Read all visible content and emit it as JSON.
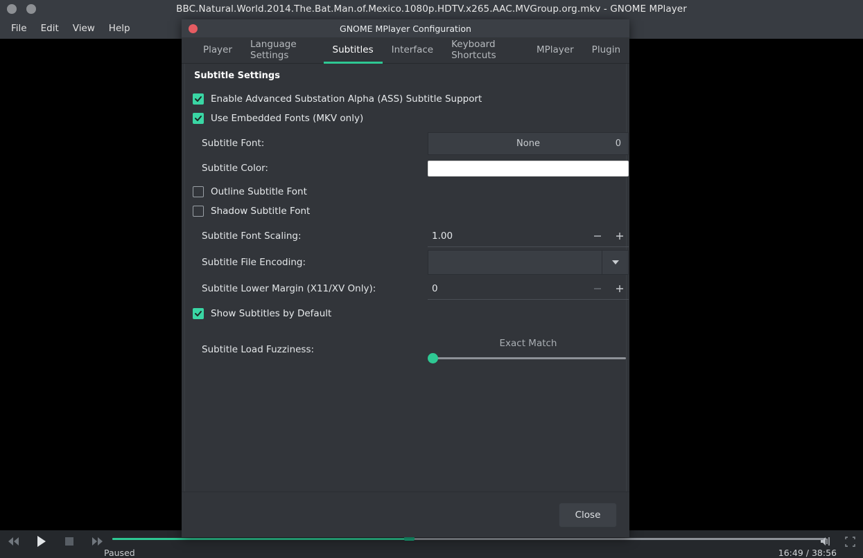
{
  "window": {
    "title": "BBC.Natural.World.2014.The.Bat.Man.of.Mexico.1080p.HDTV.x265.AAC.MVGroup.org.mkv - GNOME MPlayer",
    "menu": [
      "File",
      "Edit",
      "View",
      "Help"
    ]
  },
  "player": {
    "status": "Paused",
    "timecode": "16:49 / 38:56",
    "accent_color": "#2ec893",
    "icons": {
      "rewind": "rewind-icon",
      "play": "play-icon",
      "stop": "stop-icon",
      "forward": "fast-forward-icon",
      "volume": "volume-icon",
      "fullscreen": "fullscreen-icon"
    }
  },
  "dialog": {
    "title": "GNOME MPlayer Configuration",
    "tabs": [
      {
        "label": "Player",
        "active": false
      },
      {
        "label": "Language Settings",
        "active": false
      },
      {
        "label": "Subtitles",
        "active": true
      },
      {
        "label": "Interface",
        "active": false
      },
      {
        "label": "Keyboard Shortcuts",
        "active": false
      },
      {
        "label": "MPlayer",
        "active": false
      },
      {
        "label": "Plugin",
        "active": false
      }
    ],
    "section_title": "Subtitle Settings",
    "checkboxes": {
      "ass_support": {
        "label": "Enable Advanced Substation Alpha (ASS) Subtitle Support",
        "checked": true
      },
      "embedded_fonts": {
        "label": "Use Embedded Fonts (MKV only)",
        "checked": true
      },
      "outline_font": {
        "label": "Outline Subtitle Font",
        "checked": false
      },
      "shadow_font": {
        "label": "Shadow Subtitle Font",
        "checked": false
      },
      "show_by_default": {
        "label": "Show Subtitles by Default",
        "checked": true
      }
    },
    "font_row": {
      "label": "Subtitle Font:",
      "font_name": "None",
      "font_size": "0"
    },
    "color_row": {
      "label": "Subtitle Color:",
      "swatch_color": "#ffffff"
    },
    "scaling_row": {
      "label": "Subtitle Font Scaling:",
      "value": "1.00",
      "decrement": "−",
      "increment": "+"
    },
    "encoding_row": {
      "label": "Subtitle File Encoding:",
      "value": ""
    },
    "margin_row": {
      "label": "Subtitle Lower Margin (X11/XV Only):",
      "value": "0",
      "decrement": "−",
      "increment": "+"
    },
    "fuzziness_row": {
      "label": "Subtitle Load Fuzziness:",
      "caption": "Exact Match",
      "position_percent": 0
    },
    "close_label": "Close"
  }
}
